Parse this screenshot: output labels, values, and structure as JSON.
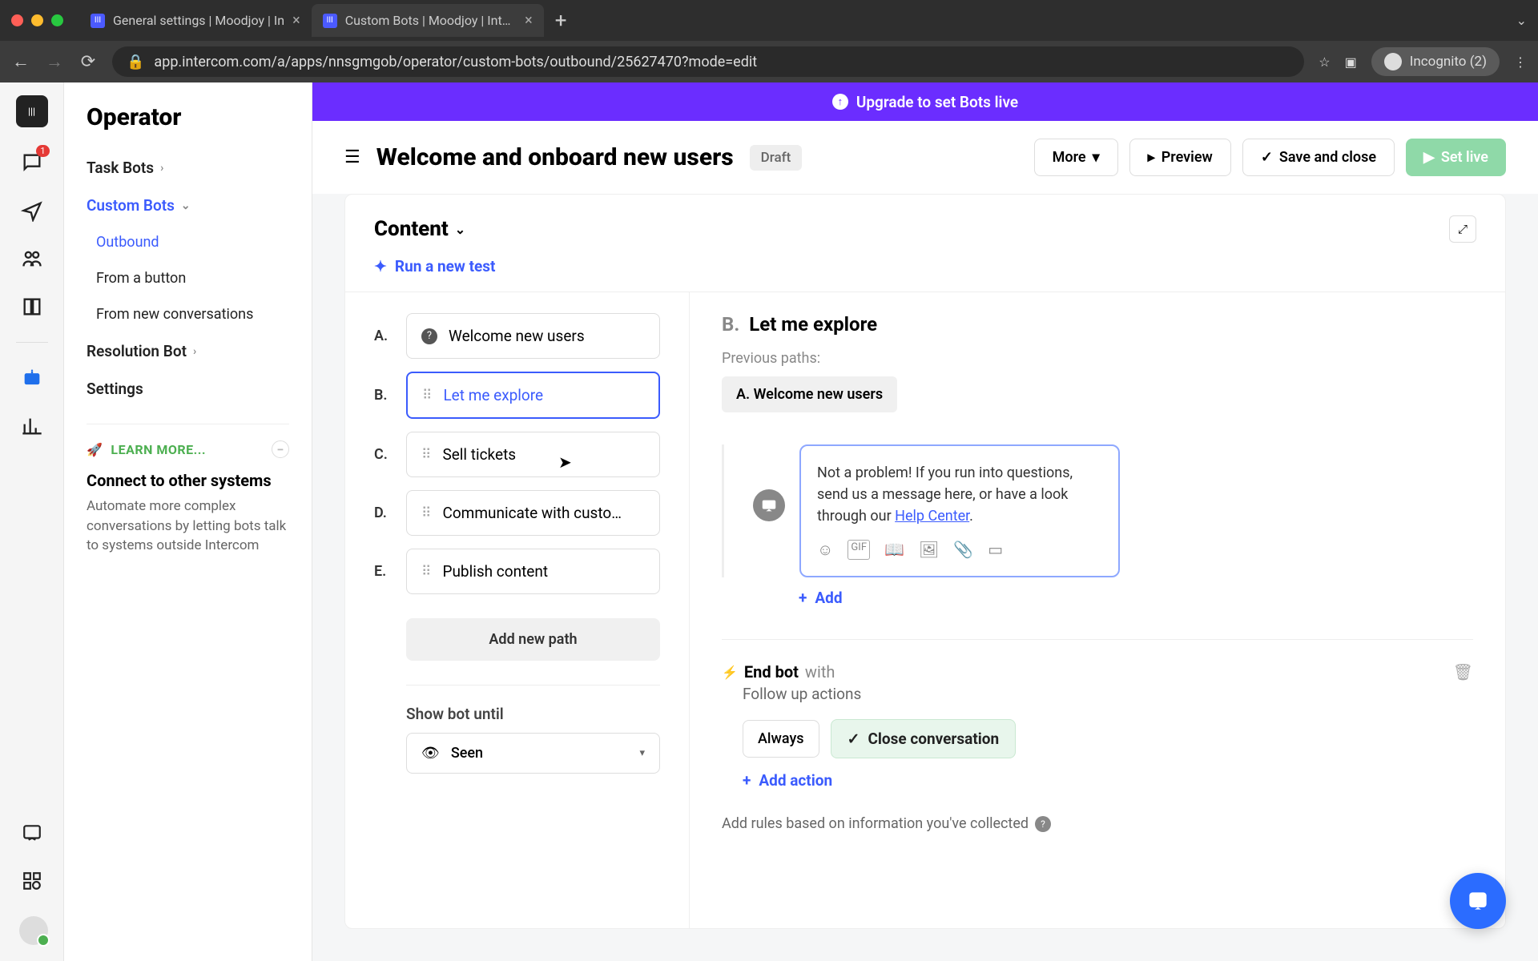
{
  "browser": {
    "tabs": [
      {
        "title": "General settings | Moodjoy | In"
      },
      {
        "title": "Custom Bots | Moodjoy | Interc"
      }
    ],
    "url": "app.intercom.com/a/apps/nnsgmgob/operator/custom-bots/outbound/25627470?mode=edit",
    "incognito": "Incognito (2)"
  },
  "sidebar": {
    "title": "Operator",
    "items": {
      "task_bots": "Task Bots",
      "custom_bots": "Custom Bots",
      "outbound": "Outbound",
      "from_button": "From a button",
      "from_new": "From new conversations",
      "resolution": "Resolution Bot",
      "settings": "Settings"
    },
    "learn_more": "LEARN MORE...",
    "connect": {
      "title": "Connect to other systems",
      "desc": "Automate more complex conversations by letting bots talk to systems outside Intercom"
    },
    "inbox_badge": "1"
  },
  "banner": "Upgrade to set Bots live",
  "header": {
    "title": "Welcome and onboard new users",
    "draft": "Draft",
    "more": "More",
    "preview": "Preview",
    "save": "Save and close",
    "set_live": "Set live"
  },
  "content": {
    "heading": "Content",
    "run_test": "Run a new test",
    "paths": [
      {
        "letter": "A.",
        "label": "Welcome new users"
      },
      {
        "letter": "B.",
        "label": "Let me explore"
      },
      {
        "letter": "C.",
        "label": "Sell tickets"
      },
      {
        "letter": "D.",
        "label": "Communicate with custo…"
      },
      {
        "letter": "E.",
        "label": "Publish content"
      }
    ],
    "add_path": "Add new path",
    "show_until": "Show bot until",
    "seen": "Seen"
  },
  "detail": {
    "letter": "B.",
    "title": "Let me explore",
    "prev_label": "Previous paths:",
    "prev_chip": "A. Welcome new users",
    "msg_pre": "Not a problem! If you run into questions, send us a message here, or have a look through our ",
    "msg_link": "Help Center",
    "msg_post": ".",
    "add": "Add",
    "end_bot": "End bot",
    "end_with": "with",
    "follow_up": "Follow up actions",
    "always": "Always",
    "close_conv": "Close conversation",
    "add_action": "Add action",
    "rules_text": "Add rules based on information you've collected"
  }
}
